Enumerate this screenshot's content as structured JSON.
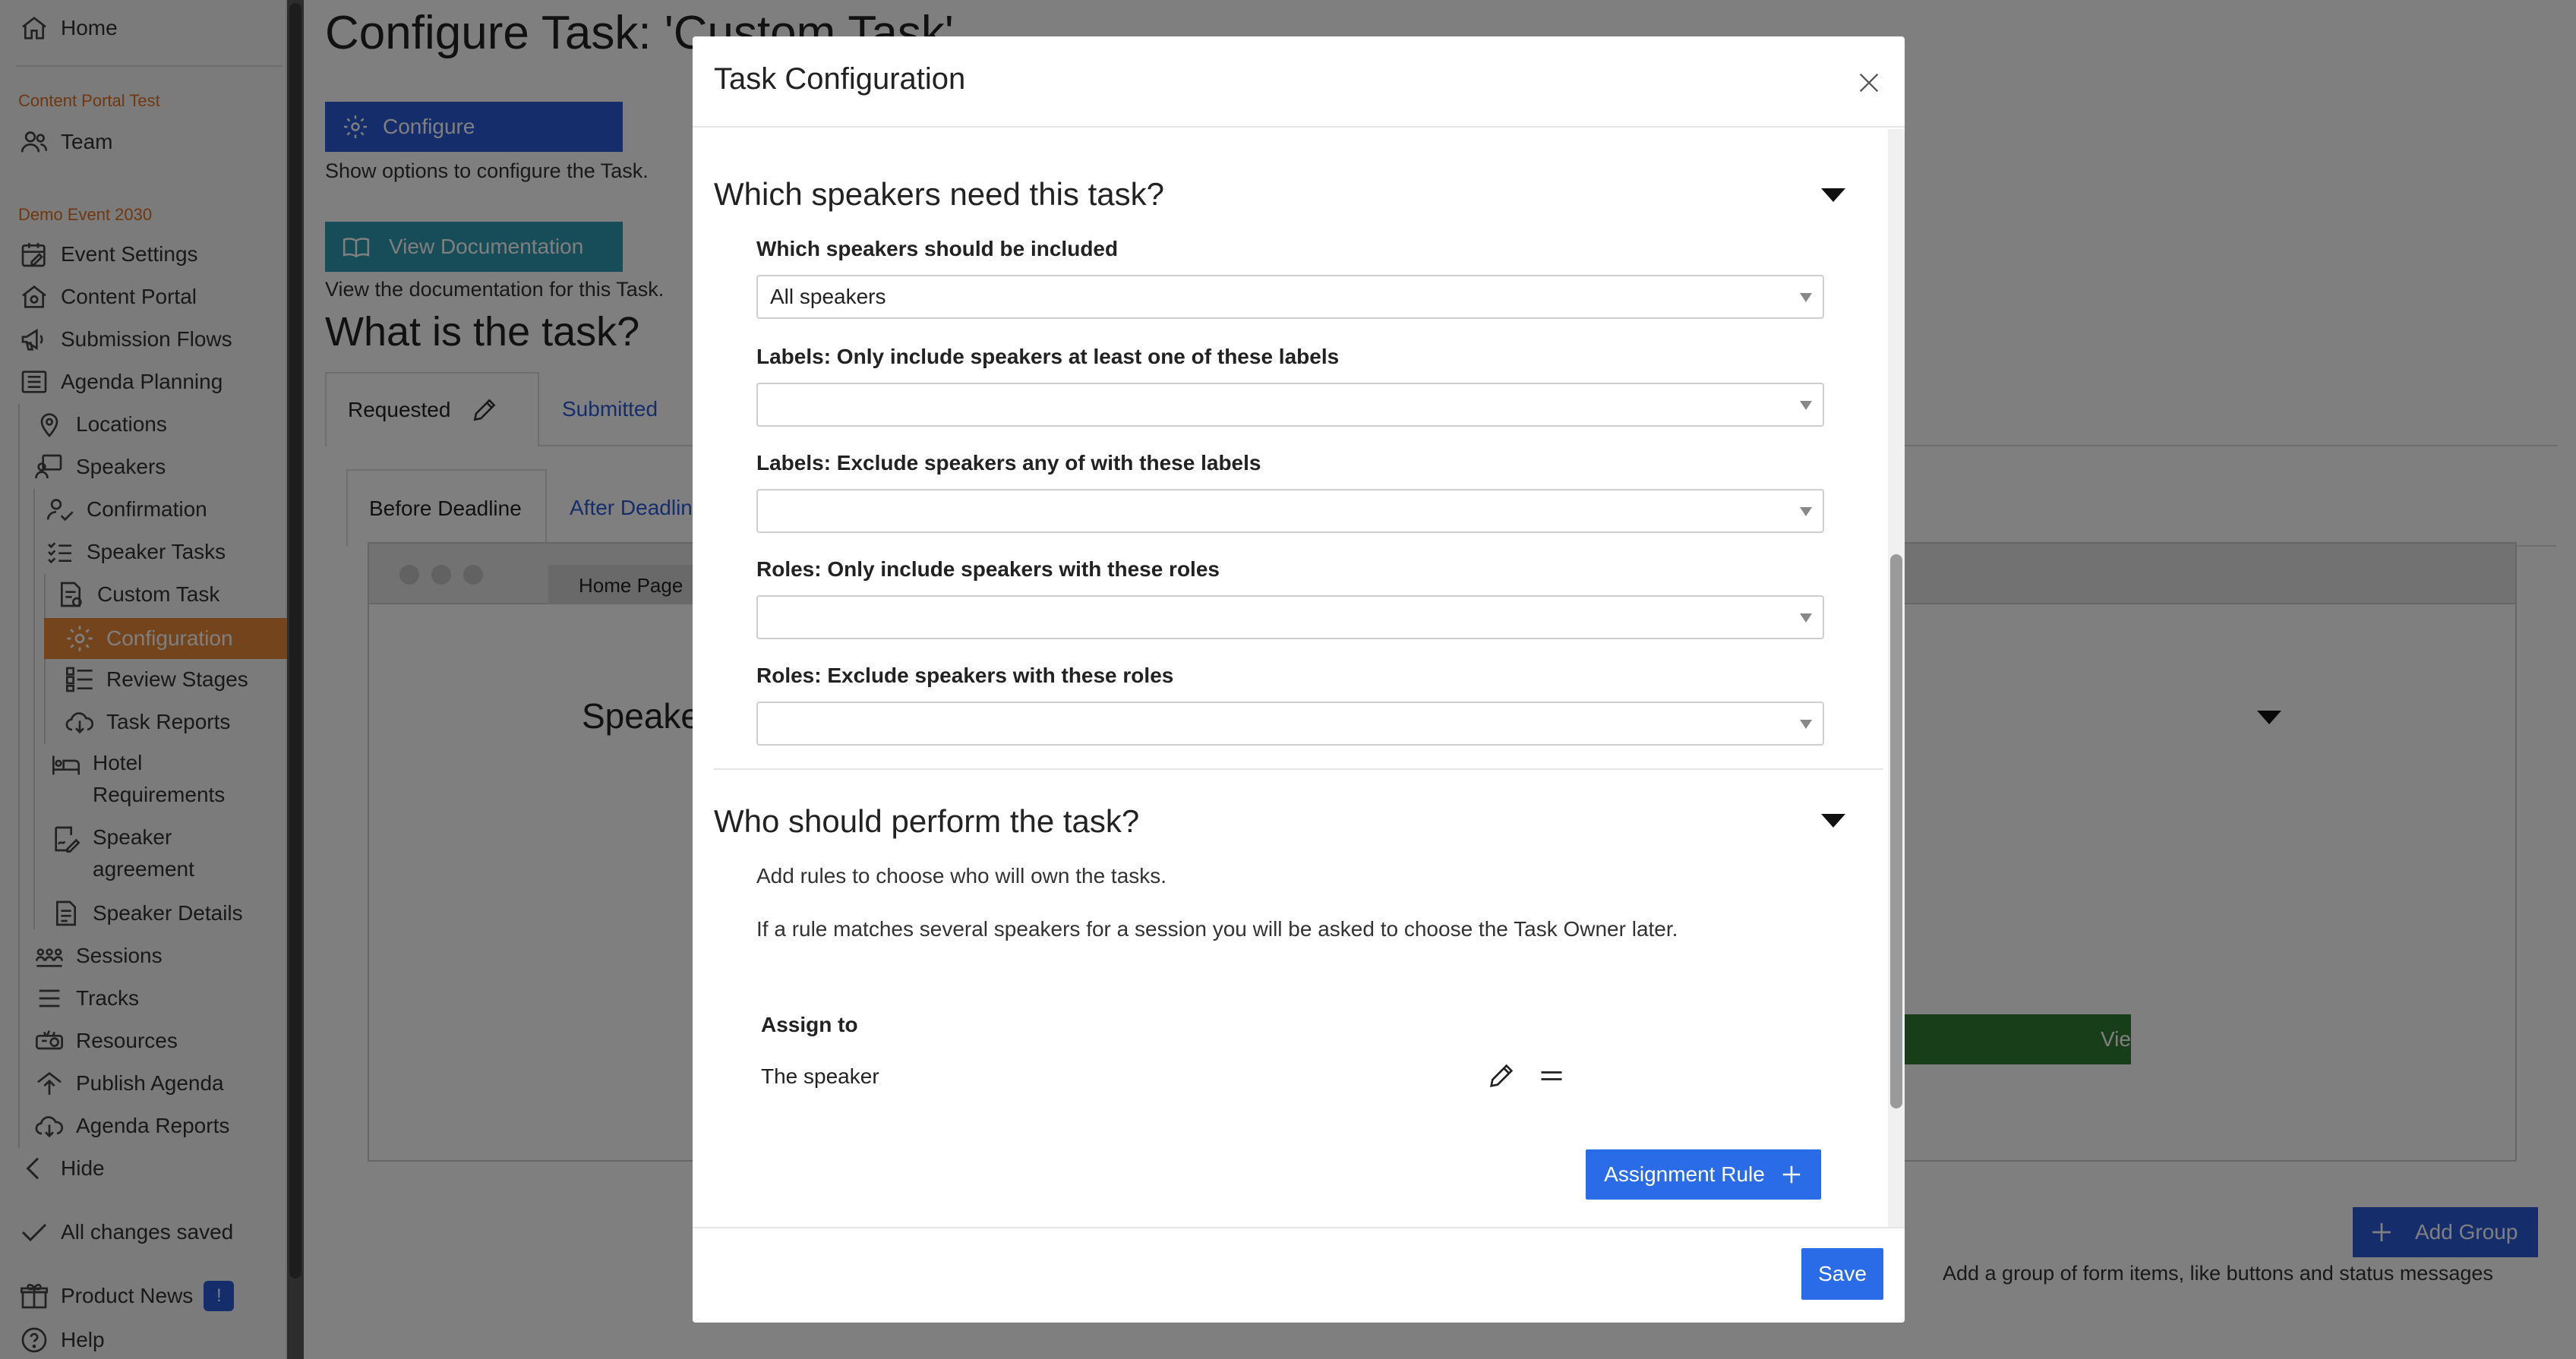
{
  "sidebar": {
    "home": "Home",
    "section_org": "Content Portal Test",
    "team": "Team",
    "section_event": "Demo Event 2030",
    "items": {
      "event_settings": "Event Settings",
      "content_portal": "Content Portal",
      "submission_flows": "Submission Flows",
      "agenda_planning": "Agenda Planning",
      "locations": "Locations",
      "speakers": "Speakers",
      "confirmation": "Confirmation",
      "speaker_tasks": "Speaker Tasks",
      "custom_task": "Custom Task",
      "configuration": "Configuration",
      "review_stages": "Review Stages",
      "task_reports": "Task Reports",
      "hotel_requirements": "Hotel Requirements",
      "speaker_agreement": "Speaker agreement",
      "speaker_details": "Speaker Details",
      "sessions": "Sessions",
      "tracks": "Tracks",
      "resources": "Resources",
      "publish_agenda": "Publish Agenda",
      "agenda_reports": "Agenda Reports",
      "hide": "Hide"
    },
    "status": "All changes saved",
    "product_news": "Product News",
    "product_news_badge": "!",
    "help": "Help"
  },
  "main": {
    "title": "Configure Task: 'Custom Task'",
    "configure_button": "Configure",
    "configure_desc": "Show options to configure the Task.",
    "docs_button": "View Documentation",
    "docs_desc": "View the documentation for this Task.",
    "what_heading": "What is the task?",
    "tabs": {
      "requested": "Requested",
      "submitted": "Submitted"
    },
    "subtabs": {
      "before": "Before Deadline",
      "after": "After Deadline"
    },
    "preview_tab": "Home Page",
    "preview_heading": "Speakers",
    "green_button": "View",
    "add_group_button": "Add Group",
    "add_group_desc": "Add a group of form items, like buttons and status messages"
  },
  "modal": {
    "title": "Task Configuration",
    "section1": {
      "title": "Which speakers need this task?",
      "fields": [
        {
          "label": "Which speakers should be included",
          "value": "All speakers"
        },
        {
          "label": "Labels: Only include speakers at least one of these labels",
          "value": ""
        },
        {
          "label": "Labels: Exclude speakers any of with these labels",
          "value": ""
        },
        {
          "label": "Roles: Only include speakers with these roles",
          "value": ""
        },
        {
          "label": "Roles: Exclude speakers with these roles",
          "value": ""
        }
      ]
    },
    "section2": {
      "title": "Who should perform the task?",
      "desc1": "Add rules to choose who will own the tasks.",
      "desc2": "If a rule matches several speakers for a session you will be asked to choose the Task Owner later.",
      "column_header": "Assign to",
      "rule": "The speaker",
      "add_rule_button": "Assignment Rule"
    },
    "save_button": "Save"
  }
}
